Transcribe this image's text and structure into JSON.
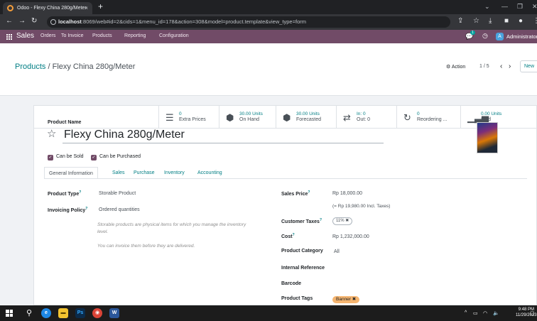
{
  "browser": {
    "tab_title": "Odoo - Flexy China 280g/Meter",
    "tab_close": "×",
    "new_tab": "+",
    "url_host": "localhost",
    "url_rest": ":8069/web#id=2&cids=1&menu_id=178&action=308&model=product.template&view_type=form"
  },
  "navbar": {
    "app_name": "Sales",
    "menus": [
      "Orders",
      "To Invoice",
      "Products",
      "Reporting",
      "Configuration"
    ],
    "chat_count": "1",
    "avatar_letter": "A",
    "user_name": "Administrator"
  },
  "control_panel": {
    "breadcrumb_parent": "Products",
    "breadcrumb_sep": " / ",
    "breadcrumb_current": "Flexy China 280g/Meter",
    "action_label": "Action",
    "pager": "1 / 5",
    "new_label": "New"
  },
  "stats": [
    {
      "value": "0",
      "label": "Extra Prices",
      "icon": "list-icon"
    },
    {
      "value": "30.00 Units",
      "label": "On Hand",
      "icon": "cubes-icon"
    },
    {
      "value": "30.00 Units",
      "label": "Forecasted",
      "icon": "cubes-icon"
    },
    {
      "value": "In:  0",
      "label": "Out:  0",
      "icon": "exchange-icon"
    },
    {
      "value": "0",
      "label": "Reordering ...",
      "icon": "refresh-icon"
    },
    {
      "value": "0.00 Units",
      "label": "Sold",
      "icon": "bar-chart-icon"
    }
  ],
  "form": {
    "name_label": "Product Name",
    "product_name": "Flexy China 280g/Meter",
    "can_be_sold": "Can be Sold",
    "can_be_purchased": "Can be Purchased",
    "tabs": [
      "General Information",
      "Sales",
      "Purchase",
      "Inventory",
      "Accounting"
    ],
    "left": {
      "product_type_label": "Product Type",
      "product_type": "Storable Product",
      "invoicing_policy_label": "Invoicing Policy",
      "invoicing_policy": "Ordered quantities",
      "help_1": "Storable products are physical items for which you manage the inventory level.",
      "help_2": "You can invoice them before they are delivered."
    },
    "right": {
      "sales_price_label": "Sales Price",
      "sales_price": "Rp 18,000.00",
      "incl_taxes": "(= Rp 19,980.00 Incl. Taxes)",
      "customer_taxes_label": "Customer Taxes",
      "customer_tax_tag": "11% ✖",
      "cost_label": "Cost",
      "cost": "Rp 1,232,000.00",
      "category_label": "Product Category",
      "category": "All",
      "internal_ref_label": "Internal Reference",
      "barcode_label": "Barcode",
      "tags_label": "Product Tags",
      "tag_banner": "Banner ✖"
    }
  },
  "taskbar": {
    "time": "9:48 PM",
    "date": "11/29/2023"
  },
  "colors": {
    "odoo_purple": "#714b67",
    "link_teal": "#017e84",
    "tag_orange": "#f5b570"
  }
}
